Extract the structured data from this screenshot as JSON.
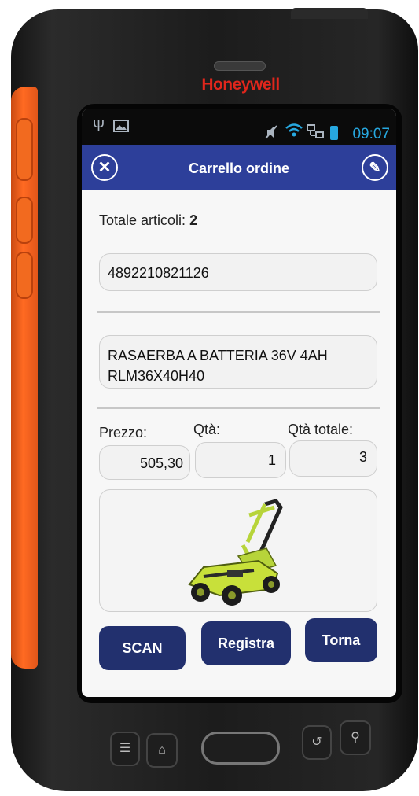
{
  "device": {
    "brand": "Honeywell"
  },
  "status_bar": {
    "time": "09:07",
    "icons": [
      "usb-icon",
      "image-icon",
      "mute-icon",
      "wifi-icon",
      "network-icon",
      "battery-icon"
    ]
  },
  "app_bar": {
    "title": "Carrello ordine",
    "close_icon": "✕",
    "edit_icon": "✎"
  },
  "order": {
    "total_label": "Totale articoli:",
    "total_value": "2",
    "barcode": "4892210821126",
    "description_line1": "RASAERBA A BATTERIA 36V 4AH",
    "description_line2": "RLM36X40H40",
    "price_label": "Prezzo:",
    "qty_label": "Qtà:",
    "qty_total_label": "Qtà totale:",
    "price_value": "505,30",
    "qty_value": "1",
    "qty_total_value": "3",
    "product_image": "lawn-mower-icon"
  },
  "buttons": {
    "scan": "SCAN",
    "save": "Registra",
    "back": "Torna"
  },
  "colors": {
    "app_bar": "#2d3f9a",
    "button": "#22306e",
    "brand": "#e0261c",
    "bumper": "#ff6a22",
    "clock": "#27a8e0"
  }
}
